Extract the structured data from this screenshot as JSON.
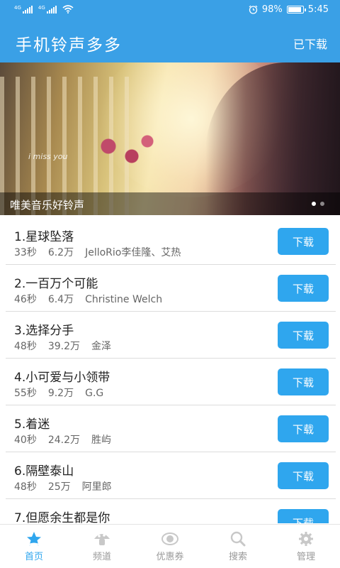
{
  "status_bar": {
    "signal1_label": "4G",
    "signal2_label": "4G",
    "battery": "98%",
    "battery_level": 0.98,
    "time": "5:45"
  },
  "app_bar": {
    "title": "手机铃声多多",
    "downloaded": "已下载"
  },
  "banner": {
    "caption": "唯美音乐好铃声",
    "image_text": "i miss you",
    "slide_count": 2,
    "active_slide": 0
  },
  "songs": [
    {
      "title": "1.星球坠落",
      "duration": "33秒",
      "plays": "6.2万",
      "artist": "JelloRio李佳隆、艾热",
      "button": "下载"
    },
    {
      "title": "2.一百万个可能",
      "duration": "46秒",
      "plays": "6.4万",
      "artist": "Christine Welch",
      "button": "下载"
    },
    {
      "title": "3.选择分手",
      "duration": "48秒",
      "plays": "39.2万",
      "artist": "金泽",
      "button": "下载"
    },
    {
      "title": "4.小可爱与小领带",
      "duration": "55秒",
      "plays": "9.2万",
      "artist": "G.G",
      "button": "下载"
    },
    {
      "title": "5.着迷",
      "duration": "40秒",
      "plays": "24.2万",
      "artist": "胜屿",
      "button": "下载"
    },
    {
      "title": "6.隔壁泰山",
      "duration": "48秒",
      "plays": "25万",
      "artist": "阿里郎",
      "button": "下载"
    },
    {
      "title": "7.但愿余生都是你",
      "duration": "",
      "plays": "",
      "artist": "",
      "button": "下载"
    }
  ],
  "bottom_nav": [
    {
      "label": "首页",
      "icon": "star-home-icon",
      "active": true
    },
    {
      "label": "频道",
      "icon": "mushroom-channel-icon",
      "active": false
    },
    {
      "label": "优惠券",
      "icon": "eye-coupon-icon",
      "active": false
    },
    {
      "label": "搜索",
      "icon": "search-icon",
      "active": false
    },
    {
      "label": "管理",
      "icon": "gear-icon",
      "active": false
    }
  ],
  "colors": {
    "primary": "#3aa0e6",
    "button": "#2fa6ee",
    "nav_inactive": "#9a9a9a"
  }
}
